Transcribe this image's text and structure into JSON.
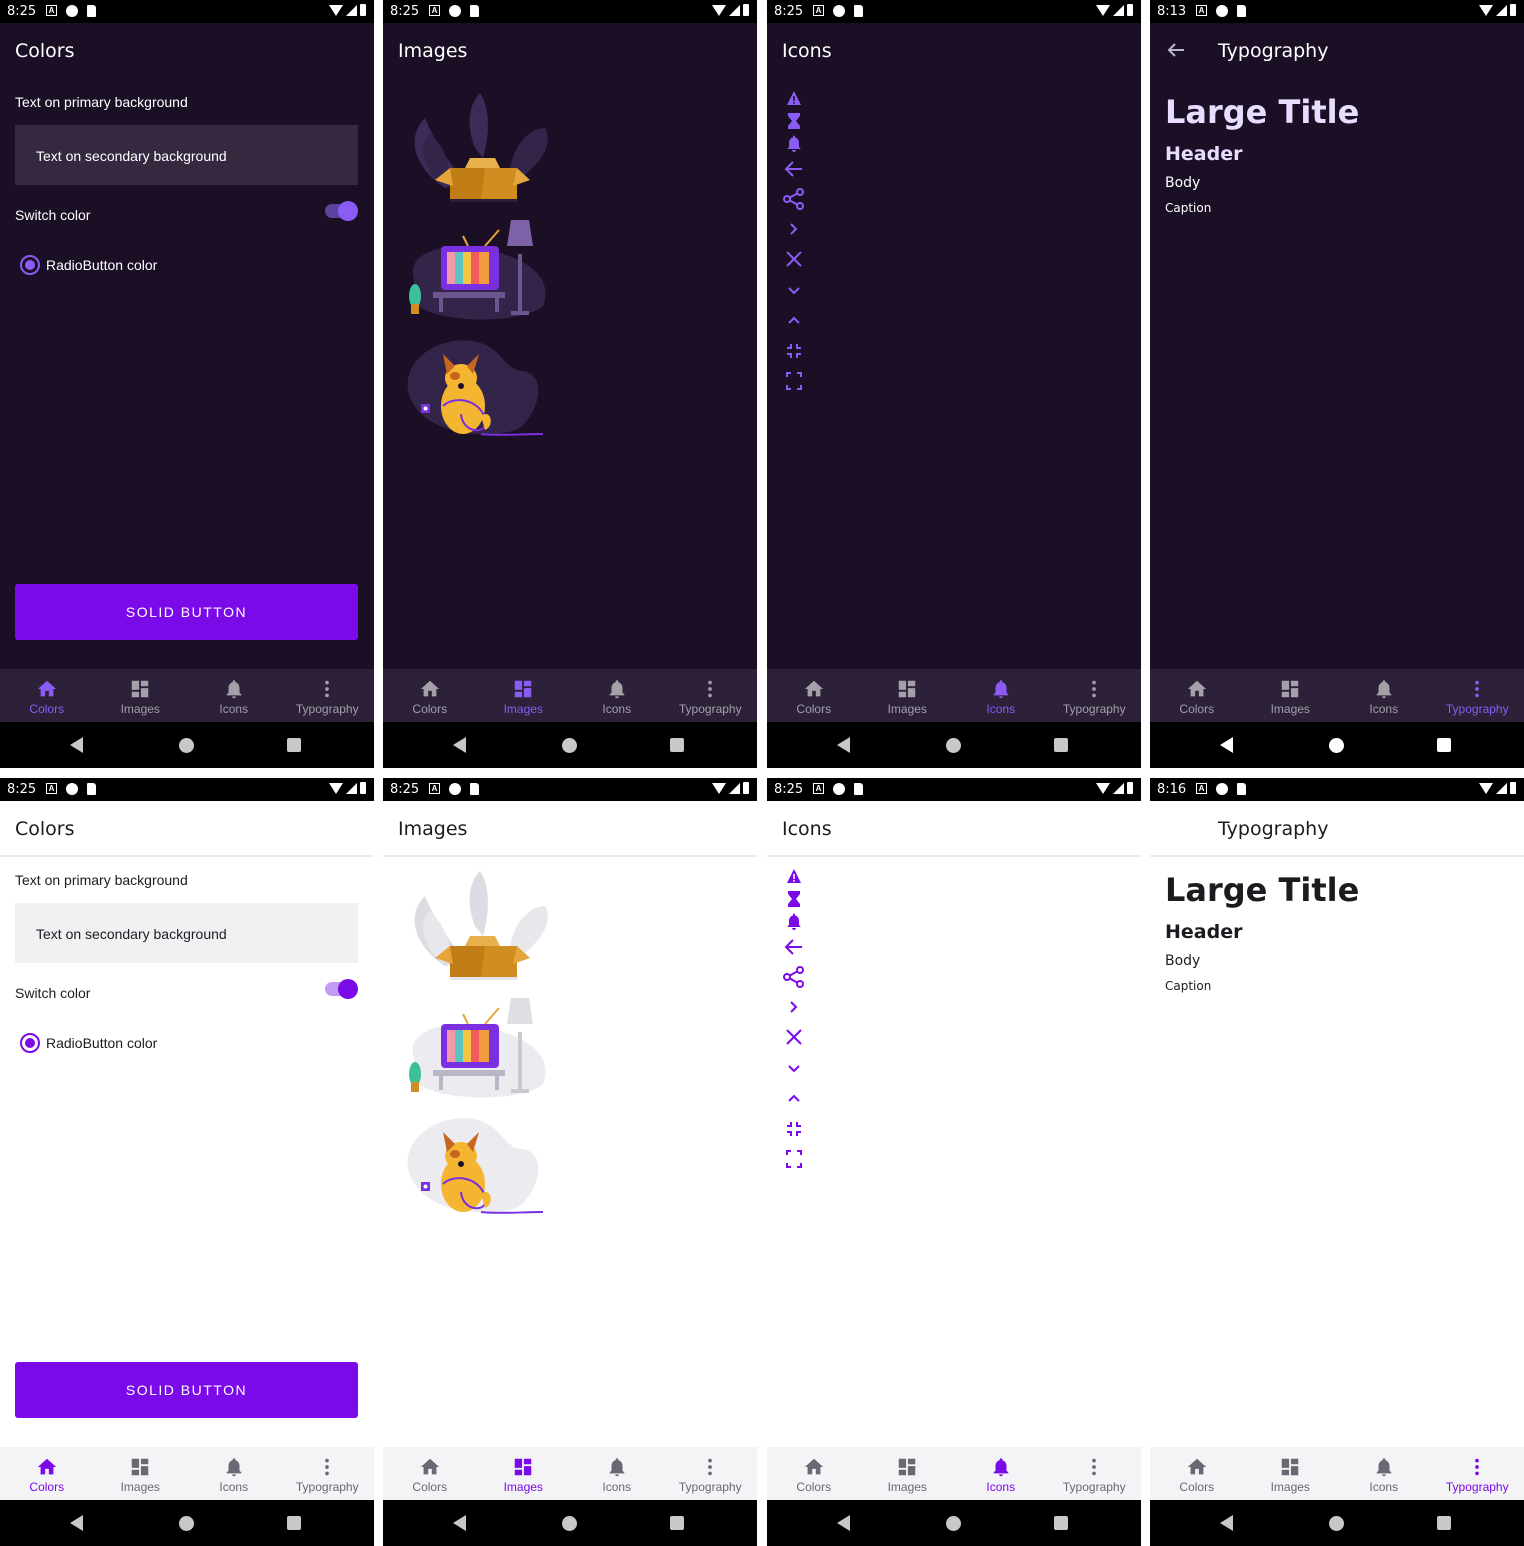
{
  "status": {
    "time_825": "8:25",
    "time_813": "8:13",
    "time_816": "8:16"
  },
  "colors_screen": {
    "title": "Colors",
    "text_primary": "Text on primary background",
    "text_secondary": "Text on secondary background",
    "switch_label": "Switch color",
    "radio_label": "RadioButton color",
    "button_label": "SOLID BUTTON"
  },
  "images_screen": {
    "title": "Images"
  },
  "icons_screen": {
    "title": "Icons",
    "icons": [
      "warning-icon",
      "hourglass-icon",
      "bell-icon",
      "arrow-back-icon",
      "share-icon",
      "chevron-right-icon",
      "close-icon",
      "chevron-down-icon",
      "chevron-up-icon",
      "exit-fullscreen-icon",
      "fullscreen-icon"
    ]
  },
  "typography_screen": {
    "title": "Typography",
    "large_title": "Large Title",
    "header": "Header",
    "body": "Body",
    "caption": "Caption"
  },
  "nav": {
    "colors": "Colors",
    "images": "Images",
    "icons": "Icons",
    "typography": "Typography"
  },
  "theme": {
    "accent_light": "#7a0ae8",
    "accent_dark": "#8a5cf5",
    "dark_bg": "#1b0f26"
  }
}
